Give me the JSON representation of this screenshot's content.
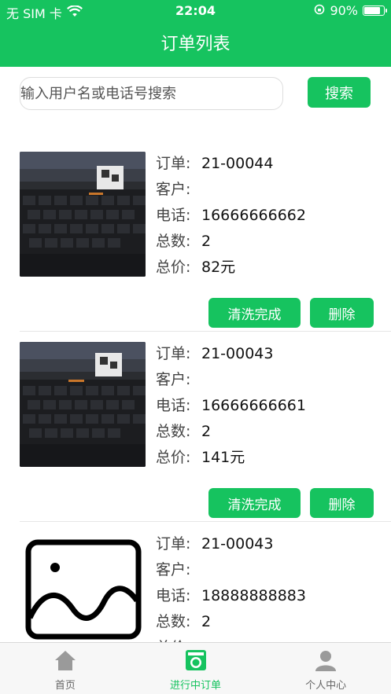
{
  "status_bar": {
    "carrier": "无 SIM 卡",
    "time": "22:04",
    "battery": "90%"
  },
  "nav": {
    "title": "订单列表"
  },
  "search": {
    "placeholder": "输入用户名或电话号搜索",
    "button": "搜索"
  },
  "labels": {
    "order": "订单:",
    "customer": "客户:",
    "phone": "电话:",
    "count": "总数:",
    "price": "总价:"
  },
  "orders": [
    {
      "id": "21-00044",
      "customer": "",
      "phone": "16666666662",
      "count": "2",
      "price": "82元",
      "image": "keyboard-photo",
      "complete_label": "清洗完成",
      "delete_label": "删除"
    },
    {
      "id": "21-00043",
      "customer": "",
      "phone": "16666666661",
      "count": "2",
      "price": "141元",
      "image": "keyboard-photo",
      "complete_label": "清洗完成",
      "delete_label": "删除"
    },
    {
      "id": "21-00043",
      "customer": "",
      "phone": "18888888883",
      "count": "2",
      "price": "",
      "image": "image-placeholder-icon"
    }
  ],
  "tabbar": {
    "tabs": [
      {
        "label": "首页",
        "icon": "home-icon",
        "active": false
      },
      {
        "label": "进行中订单",
        "icon": "washing-machine-icon",
        "active": true
      },
      {
        "label": "个人中心",
        "icon": "person-icon",
        "active": false
      }
    ]
  },
  "colors": {
    "accent": "#16c35f",
    "tab_inactive": "#666666"
  }
}
